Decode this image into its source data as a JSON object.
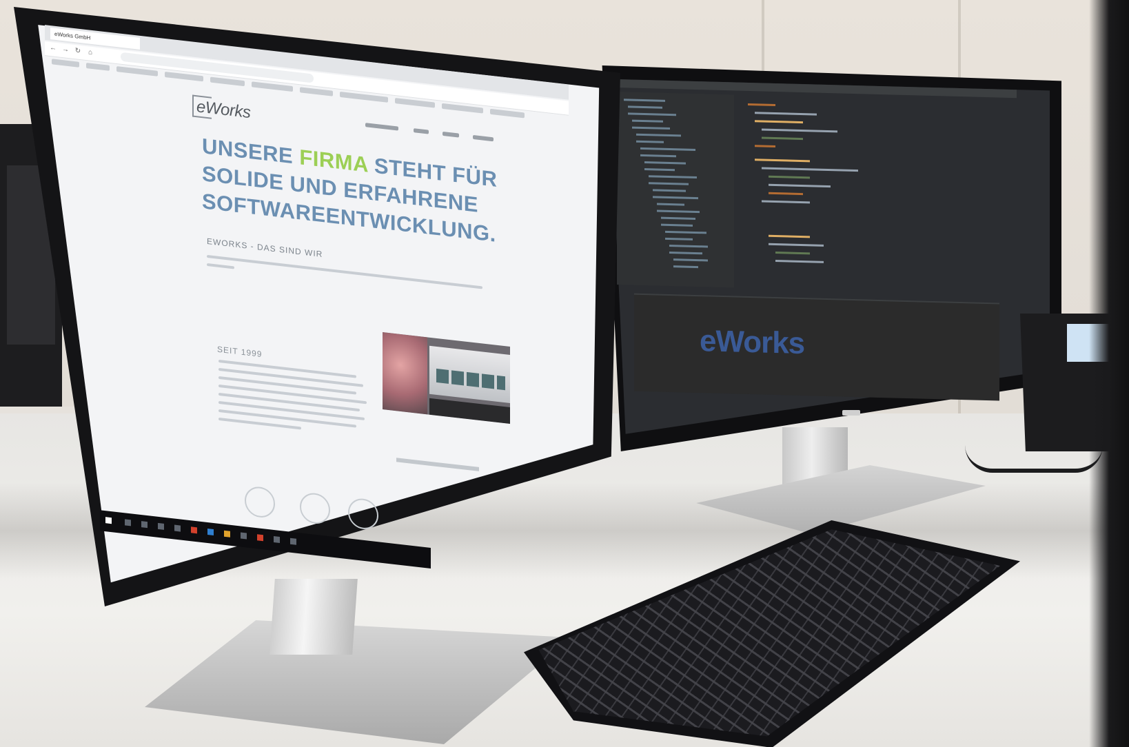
{
  "browser": {
    "tab_title": "eWorks GmbH",
    "logo_text": "eWorks",
    "headline_part1": "UNSERE ",
    "headline_highlight": "FIRMA",
    "headline_part2": " STEHT FÜR SOLIDE UND ERFAHRENE SOFTWAREENTWICKLUNG.",
    "subheading": "EWORKS - DAS SIND WIR",
    "since_label": "SEIT 1999"
  },
  "ide": {
    "console_logo": "eWorks"
  },
  "colors": {
    "headline_blue": "#6b8fb2",
    "headline_green": "#9ccf55",
    "ide_background": "#2b2d31",
    "logo_blue": "#3a5a96"
  }
}
